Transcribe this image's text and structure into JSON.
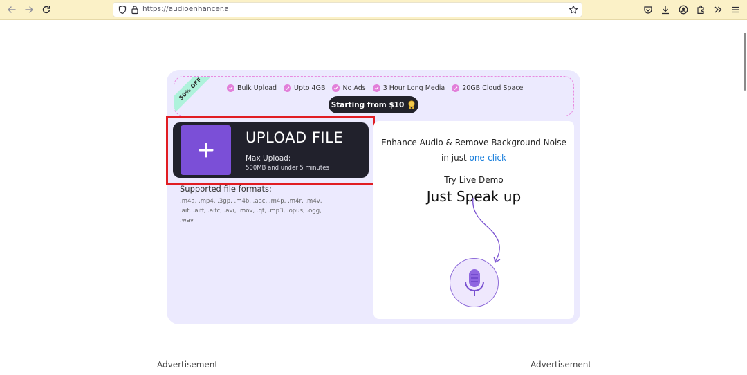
{
  "browser": {
    "url": "https://audioenhancer.ai",
    "icons": [
      "back-icon",
      "forward-icon",
      "reload-icon",
      "shield-icon",
      "lock-icon",
      "star-icon",
      "pocket-icon",
      "download-icon",
      "account-icon",
      "extensions-icon",
      "overflow-icon",
      "menu-icon"
    ]
  },
  "promo": {
    "ribbon": "50% OFF",
    "features": [
      "Bulk Upload",
      "Upto 4GB",
      "No Ads",
      "3 Hour Long Media",
      "20GB Cloud Space"
    ],
    "price_button": "Starting from $10"
  },
  "upload": {
    "title": "UPLOAD FILE",
    "max_label": "Max Upload:",
    "limit": "500MB and under 5 minutes",
    "formats_title": "Supported file formats:",
    "formats": ".m4a, .mp4, .3gp, .m4b, .aac, .m4p, .m4r, .m4v, .aif, .aiff, .aifc, .avi, .mov, .qt, .mp3, .opus, .ogg, .wav"
  },
  "demo": {
    "tagline_line1": "Enhance Audio & Remove Background Noise",
    "tagline_prefix": "in just ",
    "tagline_highlight": "one-click",
    "try_label": "Try Live Demo",
    "speak_label": "Just Speak up"
  },
  "ads": {
    "left": "Advertisement",
    "right": "Advertisement"
  },
  "colors": {
    "toolbar": "#fbf1c7",
    "card": "#eceafe",
    "upload_bg": "#21212c",
    "plus_box": "#7b4fd7",
    "highlight_outline": "#e11d23",
    "link": "#1a7fdc"
  }
}
